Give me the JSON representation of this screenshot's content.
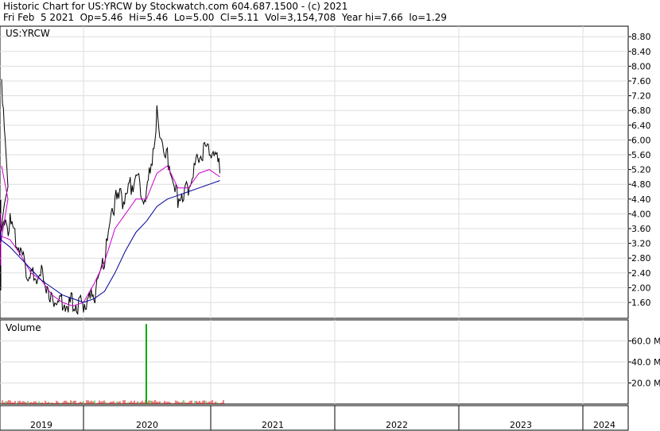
{
  "header": {
    "line1": "Historic Chart for US:YRCW by Stockwatch.com 604.687.1500 - (c) 2021",
    "line2": "Fri Feb  5 2021  Op=5.46  Hi=5.46  Lo=5.00  Cl=5.11  Vol=3,154,708  Year hi=7.66  lo=1.29"
  },
  "price_panel": {
    "label": "US:YRCW"
  },
  "volume_panel": {
    "label": "Volume"
  },
  "chart_data": [
    {
      "type": "line",
      "title": "US:YRCW",
      "y_ticks": [
        "8.80",
        "8.40",
        "8.00",
        "7.60",
        "7.20",
        "6.80",
        "6.40",
        "6.00",
        "5.60",
        "5.20",
        "4.80",
        "4.40",
        "4.00",
        "3.60",
        "3.20",
        "2.80",
        "2.40",
        "2.00",
        "1.60"
      ],
      "ylim": [
        1.3,
        9.1
      ],
      "x_ticks": [
        "2019",
        "2020",
        "2021",
        "2022",
        "2023",
        "2024"
      ],
      "grid": true,
      "series": [
        {
          "color": "#000000",
          "x": [
            "2018-11",
            "2018-12",
            "2019-01",
            "2019-02",
            "2019-03",
            "2019-04",
            "2019-05",
            "2019-06",
            "2019-07",
            "2019-08",
            "2019-09",
            "2019-10",
            "2019-11",
            "2019-12",
            "2020-01",
            "2020-02",
            "2020-03",
            "2020-04",
            "2020-05",
            "2020-06",
            "2020-07",
            "2020-08",
            "2020-09",
            "2020-10",
            "2020-11",
            "2020-12",
            "2021-01",
            "2021-02"
          ],
          "values": [
            7.5,
            4.8,
            3.6,
            2.0,
            3.8,
            4.5,
            3.3,
            3.6,
            2.8,
            2.1,
            2.3,
            1.6,
            1.5,
            1.4,
            1.4,
            1.6,
            2.7,
            4.2,
            4.3,
            4.9,
            4.2,
            6.5,
            5.4,
            4.3,
            4.6,
            5.4,
            5.6,
            5.1
          ]
        },
        {
          "color": "#cc00cc",
          "x": [
            "2018-11",
            "2018-12",
            "2019-01",
            "2019-02",
            "2019-03",
            "2019-04",
            "2019-05",
            "2019-06",
            "2019-07",
            "2019-08",
            "2019-09",
            "2019-10",
            "2019-11",
            "2019-12",
            "2020-01",
            "2020-02",
            "2020-03",
            "2020-04",
            "2020-05",
            "2020-06",
            "2020-07",
            "2020-08",
            "2020-09",
            "2020-10",
            "2020-11",
            "2020-12",
            "2021-01",
            "2021-02"
          ],
          "values": [
            5.3,
            4.4,
            3.2,
            2.6,
            3.2,
            4.0,
            3.4,
            3.3,
            2.9,
            2.4,
            2.2,
            1.8,
            1.6,
            1.5,
            1.6,
            2.1,
            2.7,
            3.6,
            4.0,
            4.4,
            4.4,
            5.1,
            5.3,
            4.7,
            4.7,
            5.1,
            5.2,
            5.0
          ]
        },
        {
          "color": "#000099",
          "x": [
            "2019-02",
            "2019-03",
            "2019-04",
            "2019-05",
            "2019-06",
            "2019-07",
            "2019-08",
            "2019-09",
            "2019-10",
            "2019-11",
            "2019-12",
            "2020-01",
            "2020-02",
            "2020-03",
            "2020-04",
            "2020-05",
            "2020-06",
            "2020-07",
            "2020-08",
            "2020-09",
            "2020-10",
            "2020-11",
            "2020-12",
            "2021-01",
            "2021-02"
          ],
          "values": [
            3.5,
            3.4,
            3.4,
            3.3,
            3.1,
            2.8,
            2.5,
            2.2,
            2.0,
            1.8,
            1.7,
            1.6,
            1.7,
            1.9,
            2.4,
            3.0,
            3.5,
            3.8,
            4.2,
            4.4,
            4.5,
            4.6,
            4.7,
            4.8,
            4.9
          ]
        }
      ]
    },
    {
      "type": "bar",
      "title": "Volume",
      "y_ticks": [
        "60.0 M",
        "40.0 M",
        "20.0 M"
      ],
      "ylim": [
        0,
        80
      ],
      "x": [
        "2020-03"
      ],
      "values": [
        76
      ],
      "baseline_color": "#cc0000",
      "spike_color": "#00aa00"
    }
  ]
}
